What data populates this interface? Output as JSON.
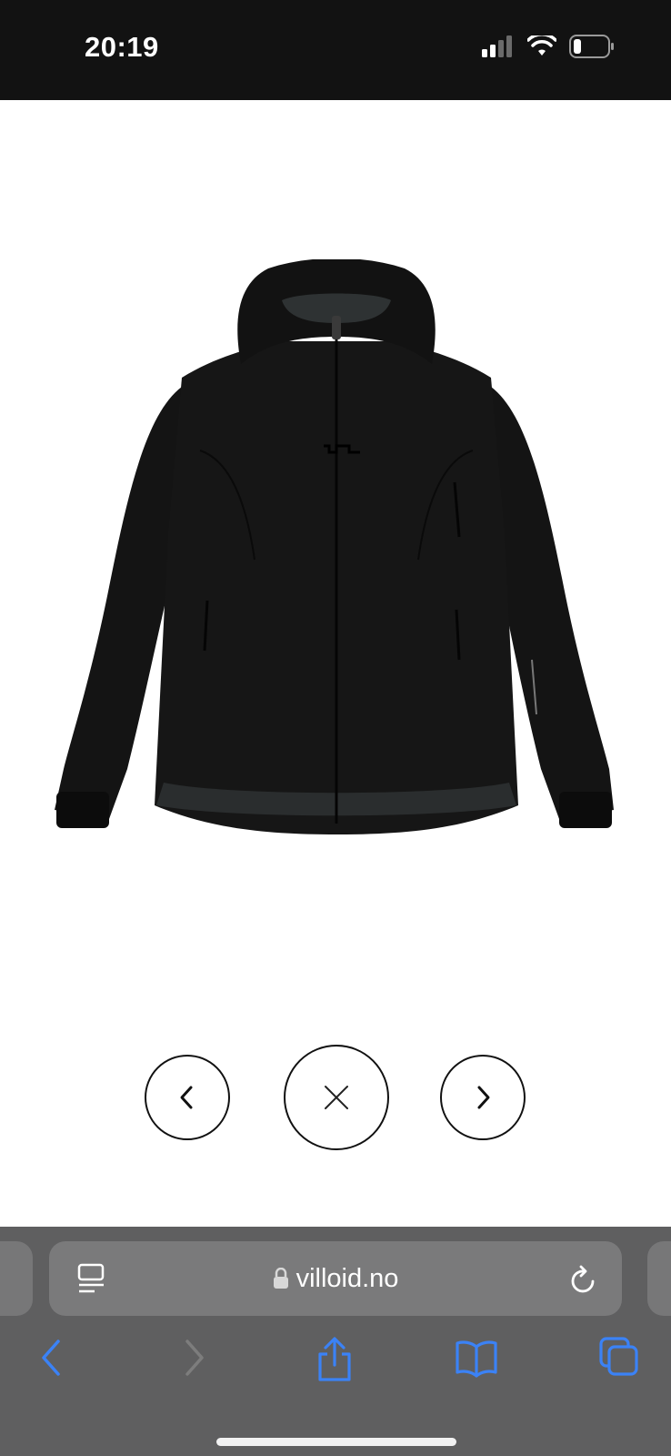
{
  "status_bar": {
    "time": "20:19",
    "icons": [
      "signal-icon",
      "wifi-icon",
      "battery-icon"
    ]
  },
  "product": {
    "image": "black-hooded-ski-jacket",
    "icons": {
      "prev": "chevron-left-icon",
      "close": "close-icon",
      "next": "chevron-right-icon"
    }
  },
  "browser": {
    "url": "villoid.no",
    "icons": {
      "reader": "reader-mode-icon",
      "lock": "lock-icon",
      "reload": "reload-icon",
      "back": "back-arrow-icon",
      "forward": "forward-arrow-icon",
      "share": "share-icon",
      "bookmarks": "bookmarks-icon",
      "tabs": "tabs-icon"
    },
    "colors": {
      "accent": "#3b82f6",
      "bar": "#5f5f60",
      "field": "#7a7a7b"
    }
  }
}
